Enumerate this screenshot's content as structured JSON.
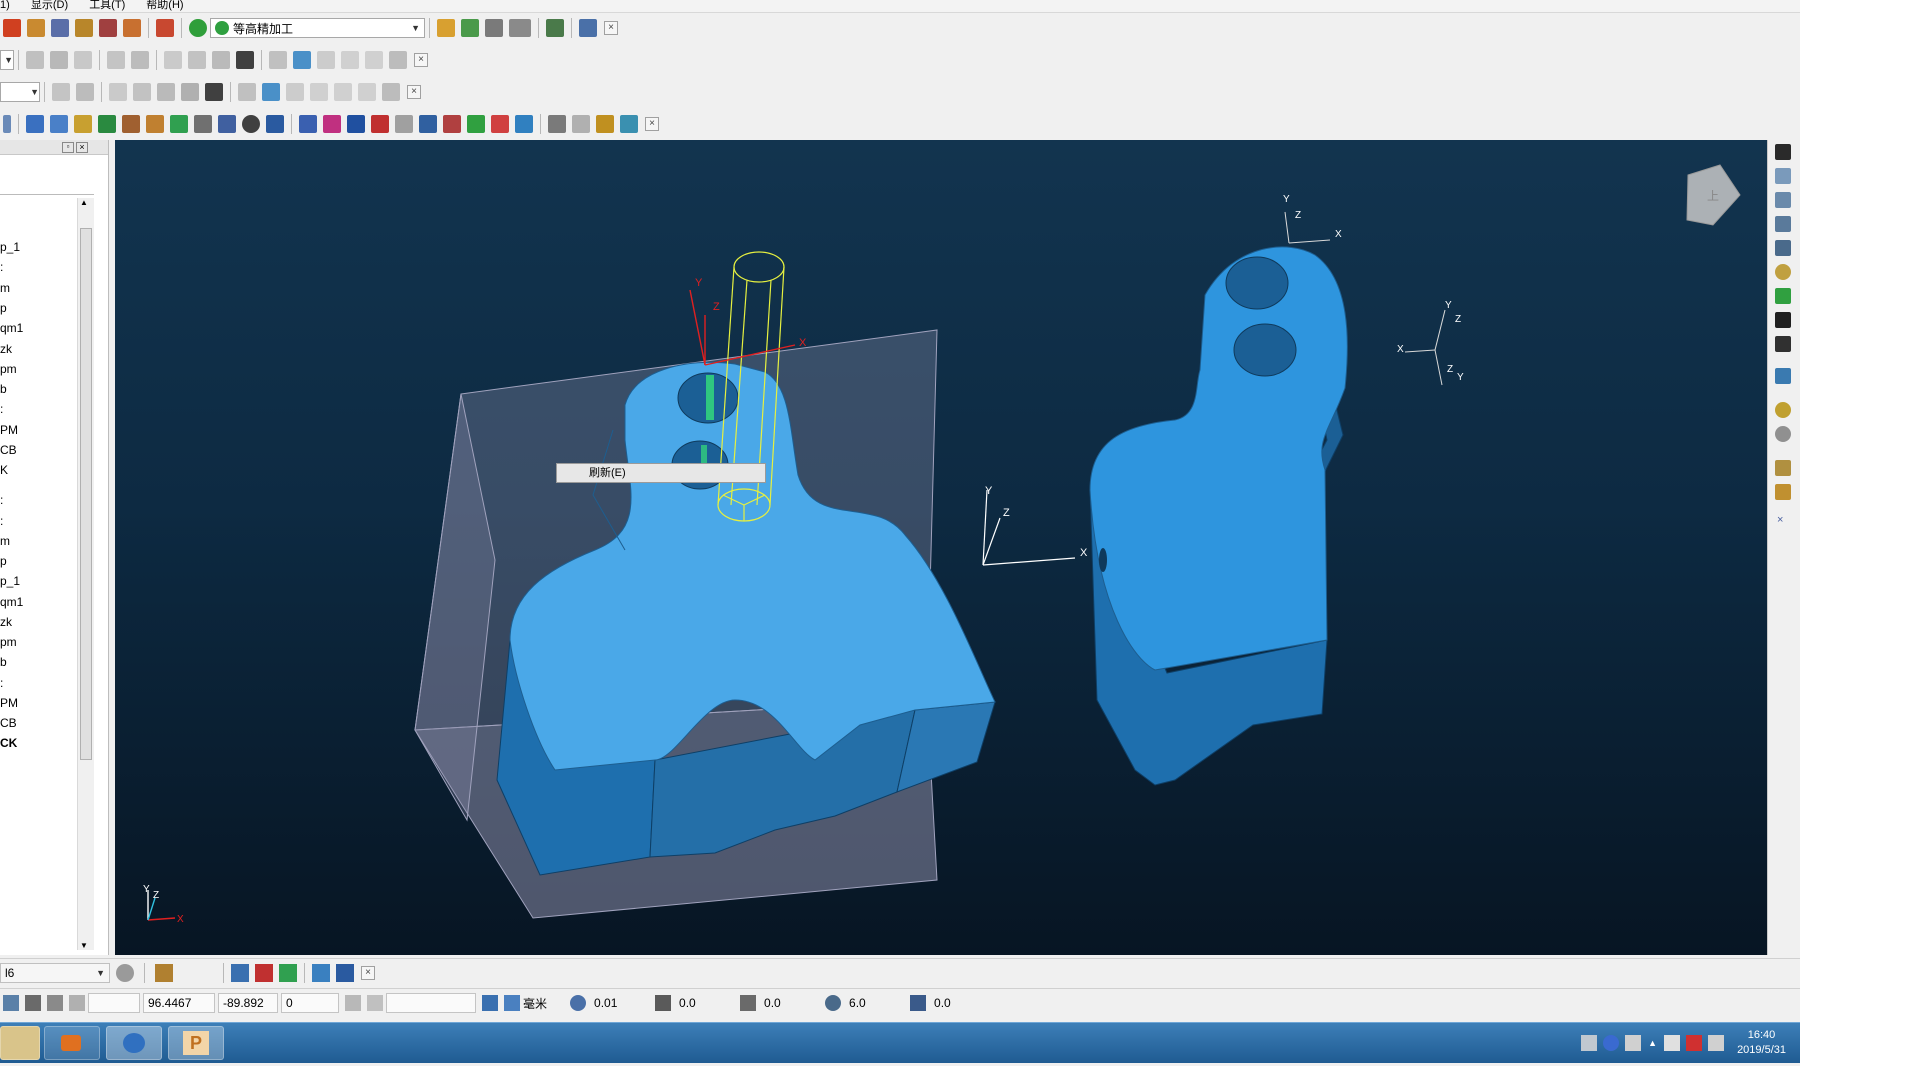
{
  "menubar": {
    "items": [
      "1)",
      "显示(D)",
      "工具(T)",
      "帮助(H)"
    ]
  },
  "toolbar1": {
    "combo_value": "等高精加工"
  },
  "context_menu": {
    "item": "刷新(E)"
  },
  "tree": {
    "items": [
      "p_1",
      ":",
      "m",
      "p",
      "qm1",
      "zk",
      "pm",
      "b",
      ":",
      "PM",
      "CB",
      "K",
      ":",
      ":",
      "m",
      "p",
      "p_1",
      "qm1",
      "zk",
      "pm",
      "b",
      ":",
      "PM",
      "CB",
      "CK"
    ]
  },
  "viewport": {
    "triad_labels": {
      "y": "Y",
      "z": "Z",
      "x": "X"
    },
    "viewcube_label": "上",
    "colors": {
      "part": "#2e95de",
      "stock": "#8a8ca8",
      "background": "#0d2a42",
      "tool": "#e6f040"
    }
  },
  "bottom_toolbar": {
    "combo_value": "l6"
  },
  "statusbar": {
    "x": "96.4467",
    "y": "-89.892",
    "z": "0",
    "units": "毫米",
    "tolerance": "0.01",
    "thickness": "0.0",
    "axial_thickness": "0.0",
    "diameter": "6.0",
    "angle": "0.0"
  },
  "taskbar": {
    "time": "16:40",
    "date": "2019/5/31"
  }
}
